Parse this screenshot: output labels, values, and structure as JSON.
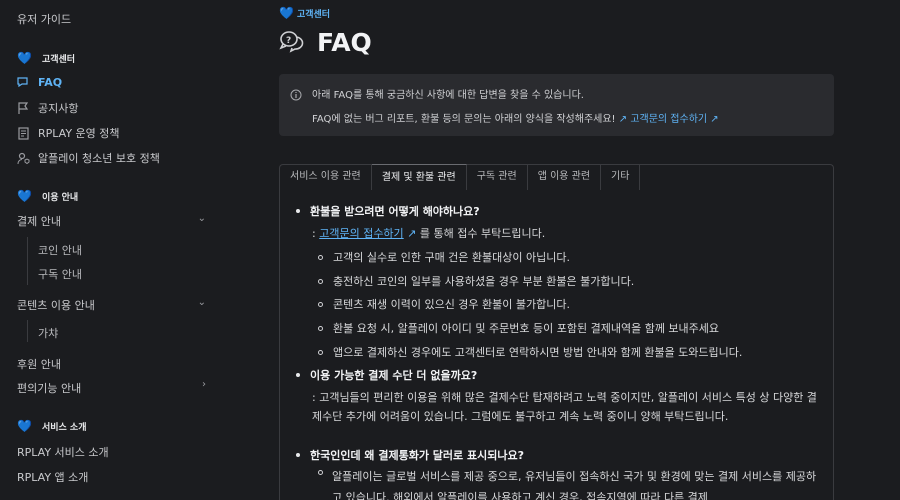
{
  "sidebar": {
    "top_link": "유저 가이드",
    "sections": [
      {
        "title": "고객센터"
      },
      {
        "title": "이용 안내"
      },
      {
        "title": "서비스 소개"
      }
    ],
    "faq": "FAQ",
    "notice": "공지사항",
    "policy": "RPLAY 운영 정책",
    "youth": "알플레이 청소년 보호 정책",
    "payment": "결제 안내",
    "coin": "코인 안내",
    "subscription": "구독 안내",
    "content_use": "콘텐츠 이용 안내",
    "gacha": "가챠",
    "donation": "후원 안내",
    "convenience": "편의기능 안내",
    "service_intro": "RPLAY 서비스 소개",
    "app_intro": "RPLAY 앱 소개"
  },
  "main": {
    "breadcrumb": "고객센터",
    "title": "FAQ",
    "notice_line1": "아래 FAQ를 통해 궁금하신 사항에 대한 답변을 찾을 수 있습니다.",
    "notice_line2_prefix": "FAQ에 없는 버그 리포트, 환불 등의 문의는 아래의 양식을 작성해주세요!",
    "notice_link": "고객문의 접수하기",
    "tabs": [
      "서비스 이용 관련",
      "결제 및 환불 관련",
      "구독 관련",
      "앱 이용 관련",
      "기타"
    ],
    "q1": "환불을 받으려면 어떻게 해야하나요?",
    "q1_prefix": ":",
    "q1_link": "고객문의 접수하기",
    "q1_suffix": "를 통해 접수 부탁드립니다.",
    "q1_items": [
      "고객의 실수로 인한 구매 건은 환불대상이 아닙니다.",
      "충전하신 코인의 일부를 사용하셨을 경우 부분 환불은 불가합니다.",
      "콘텐츠 재생 이력이 있으신 경우 환불이 불가합니다.",
      "환불 요청 시, 알플레이 아이디 및 주문번호 등이 포함된 결제내역을 함께 보내주세요",
      "앱으로 결제하신 경우에도 고객센터로 연락하시면 방법 안내와 함께 환불을 도와드립니다."
    ],
    "q2": "이용 가능한 결제 수단 더 없을까요?",
    "q2_answer": ": 고객님들의 편리한 이용을 위해 많은 결제수단 탑재하려고 노력 중이지만, 알플레이 서비스 특성 상 다양한 결제수단 추가에 어려움이 있습니다. 그럼에도 불구하고 계속 노력 중이니 양해 부탁드립니다.",
    "q3": "한국인인데 왜 결제통화가 달러로 표시되나요?",
    "q3_answer": "알플레이는 글로벌 서비스를 제공 중으로, 유저님들이 접속하신 국가 및 환경에 맞는 결제 서비스를 제공하고 있습니다. 해외에서 알플레이를 사용하고 계신 경우, 접속지역에 따라 다른 결제"
  }
}
